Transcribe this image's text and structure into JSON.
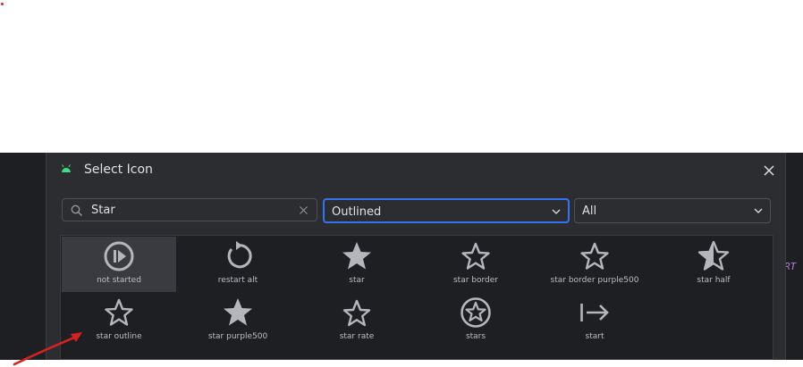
{
  "dialog": {
    "title": "Select Icon",
    "close_icon": "close-icon",
    "title_icon": "android-icon"
  },
  "search": {
    "value": "Star",
    "placeholder": ""
  },
  "style_dropdown": {
    "selected": "Outlined"
  },
  "category_dropdown": {
    "selected": "All"
  },
  "icons": [
    {
      "label": "not started",
      "icon": "not-started-icon",
      "selected": true
    },
    {
      "label": "restart alt",
      "icon": "restart-alt-icon"
    },
    {
      "label": "star",
      "icon": "star-icon"
    },
    {
      "label": "star border",
      "icon": "star-border-icon"
    },
    {
      "label": "star border purple500",
      "icon": "star-border-purple500-icon"
    },
    {
      "label": "star half",
      "icon": "star-half-icon"
    },
    {
      "label": "star outline",
      "icon": "star-outline-icon"
    },
    {
      "label": "star purple500",
      "icon": "star-purple500-icon"
    },
    {
      "label": "star rate",
      "icon": "star-rate-icon"
    },
    {
      "label": "stars",
      "icon": "stars-icon"
    },
    {
      "label": "start",
      "icon": "start-icon"
    }
  ],
  "editor_fragment": "RT",
  "colors": {
    "dialog_bg": "#2b2d30",
    "grid_bg": "#1e1f22",
    "accent_focus": "#3574f0",
    "icon_fill": "#b4b6bb",
    "annotation_red": "#d22222"
  }
}
